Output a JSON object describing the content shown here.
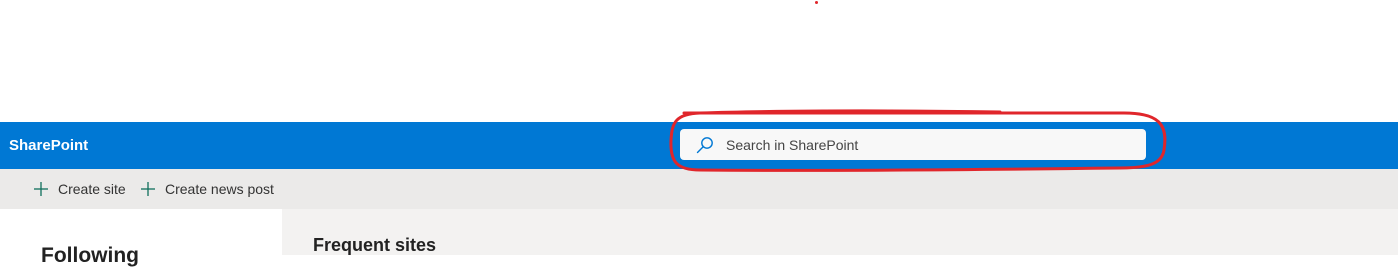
{
  "suite_bar": {
    "app_name": "SharePoint",
    "accent_color": "#0078d4",
    "search": {
      "placeholder": "Search in SharePoint",
      "value": "",
      "icon": "search-icon"
    }
  },
  "command_bar": {
    "items": [
      {
        "label": "Create site",
        "icon": "plus-icon"
      },
      {
        "label": "Create news post",
        "icon": "plus-icon"
      }
    ]
  },
  "left_panel": {
    "title": "Following"
  },
  "main": {
    "section_title": "Frequent sites"
  },
  "annotation": {
    "color": "#e0262b"
  }
}
